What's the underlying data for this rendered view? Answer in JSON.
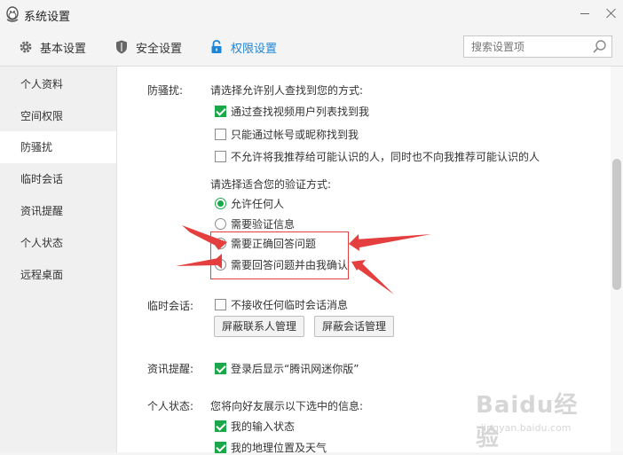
{
  "window": {
    "title": "系统设置"
  },
  "tabs": [
    {
      "label": "基本设置",
      "icon": "gear-icon"
    },
    {
      "label": "安全设置",
      "icon": "shield-icon"
    },
    {
      "label": "权限设置",
      "icon": "lock-icon",
      "active": true
    }
  ],
  "search": {
    "placeholder": "搜索设置项"
  },
  "sidebar": {
    "items": [
      {
        "label": "个人资料"
      },
      {
        "label": "空间权限"
      },
      {
        "label": "防骚扰",
        "active": true
      },
      {
        "label": "临时会话"
      },
      {
        "label": "资讯提醒"
      },
      {
        "label": "个人状态"
      },
      {
        "label": "远程桌面"
      }
    ]
  },
  "harassment": {
    "label": "防骚扰:",
    "find_prompt": "请选择允许别人查找到您的方式:",
    "find_options": [
      {
        "label": "通过查找视频用户列表找到我",
        "checked": true
      },
      {
        "label": "只能通过帐号或昵称找到我",
        "checked": false
      },
      {
        "label": "不允许将我推荐给可能认识的人，同时也不向我推荐可能认识的人",
        "checked": false
      }
    ],
    "verify_prompt": "请选择适合您的验证方式:",
    "verify_options": [
      {
        "label": "允许任何人",
        "selected": true
      },
      {
        "label": "需要验证信息",
        "selected": false
      },
      {
        "label": "需要正确回答问题",
        "selected": false
      },
      {
        "label": "需要回答问题并由我确认",
        "selected": false
      }
    ]
  },
  "temp_chat": {
    "label": "临时会话:",
    "option": {
      "label": "不接收任何临时会话消息",
      "checked": false
    },
    "buttons": {
      "block_contacts": "屏蔽联系人管理",
      "block_sessions": "屏蔽会话管理"
    }
  },
  "news": {
    "label": "资讯提醒:",
    "option": {
      "label": "登录后显示“腾讯网迷你版”",
      "checked": true
    }
  },
  "status": {
    "label": "个人状态:",
    "prompt": "您将向好友展示以下选中的信息:",
    "options": [
      {
        "label": "我的输入状态",
        "checked": true
      },
      {
        "label": "我的地理位置及天气",
        "checked": true
      }
    ]
  },
  "watermark": {
    "brand": "Baidu经验",
    "url": "jingyan.baidu.com"
  },
  "colors": {
    "accent": "#1d86d6",
    "check_green": "#1aa84a",
    "annotation_red": "#e53e3e"
  }
}
